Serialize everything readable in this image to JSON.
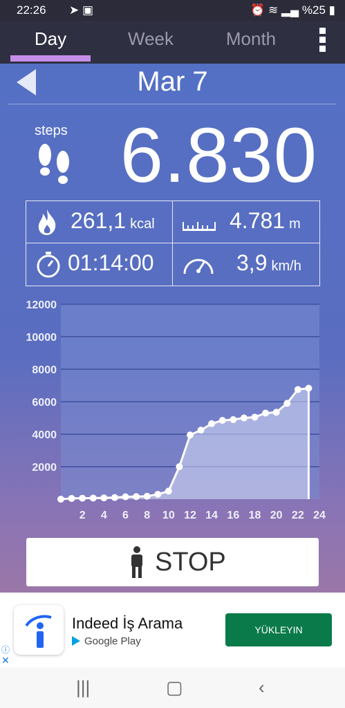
{
  "status_bar": {
    "time": "22:26",
    "battery": "%25"
  },
  "tabs": [
    {
      "label": "Day"
    },
    {
      "label": "Week"
    },
    {
      "label": "Month"
    }
  ],
  "header": {
    "date": "Mar 7"
  },
  "steps": {
    "label": "steps",
    "value": "6.830"
  },
  "stats": {
    "calories": {
      "value": "261,1",
      "unit": "kcal"
    },
    "distance": {
      "value": "4.781",
      "unit": "m"
    },
    "duration": {
      "value": "01:14:00"
    },
    "speed": {
      "value": "3,9",
      "unit": "km/h"
    }
  },
  "chart_data": {
    "type": "area",
    "x": [
      0,
      1,
      2,
      3,
      4,
      5,
      6,
      7,
      8,
      9,
      10,
      11,
      12,
      13,
      14,
      15,
      16,
      17,
      18,
      19,
      20,
      21,
      22,
      23
    ],
    "series": [
      {
        "values": [
          0,
          50,
          60,
          70,
          80,
          100,
          150,
          160,
          180,
          300,
          500,
          2000,
          3950,
          4250,
          4650,
          4850,
          4900,
          5000,
          5050,
          5300,
          5350,
          5900,
          6750,
          6830
        ]
      }
    ],
    "ylim": [
      0,
      12000
    ],
    "yticks": [
      2000,
      4000,
      6000,
      8000,
      10000,
      12000
    ],
    "xlim": [
      0,
      24
    ],
    "xticks": [
      2,
      4,
      6,
      8,
      10,
      12,
      14,
      16,
      18,
      20,
      22,
      24
    ]
  },
  "stop_button": {
    "label": "STOP"
  },
  "ad": {
    "title": "Indeed İş Arama",
    "store": "Google Play",
    "button": "YÜKLEYIN"
  },
  "colors": {
    "accent": "#c58ee8",
    "chart_line": "#ffffff",
    "ad_button": "#0b7a4a"
  }
}
